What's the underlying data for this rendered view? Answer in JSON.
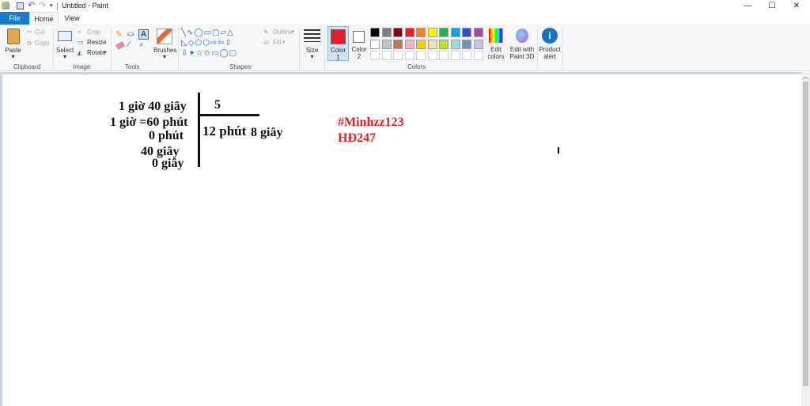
{
  "window": {
    "title": "Untitled - Paint",
    "minimize": "—",
    "maximize": "☐",
    "close": "✕"
  },
  "tabs": {
    "file": "File",
    "home": "Home",
    "view": "View"
  },
  "clipboard": {
    "paste": "Paste",
    "cut": "Cut",
    "copy": "Copy",
    "group": "Clipboard"
  },
  "image": {
    "select": "Select",
    "crop": "Crop",
    "resize": "Resize",
    "rotate": "Rotate",
    "group": "Image"
  },
  "tools": {
    "group": "Tools",
    "brushes": "Brushes"
  },
  "shapes": {
    "group": "Shapes",
    "outline": "Outline",
    "fill": "Fill",
    "size": "Size"
  },
  "colors": {
    "color1": "Color 1",
    "color2": "Color 2",
    "group": "Colors",
    "edit_colors": "Edit colors",
    "edit_paint3d": "Edit with Paint 3D",
    "product_alert": "Product alert",
    "color1_value": "#e02127",
    "color2_value": "#ffffff",
    "palette_row1": [
      "#000000",
      "#7f7f7f",
      "#880015",
      "#ed1c24",
      "#ff7f27",
      "#fff200",
      "#22b14c",
      "#00a2e8",
      "#3f48cc",
      "#a349a4"
    ],
    "palette_row2": [
      "#ffffff",
      "#c3c3c3",
      "#b97a57",
      "#ffaec9",
      "#ffc90e",
      "#efe4b0",
      "#b5e61d",
      "#99d9ea",
      "#7092be",
      "#c8bfe7"
    ]
  },
  "canvas_text": {
    "line1": "1 giờ 40 giây",
    "line2": "1 giờ =60 phút",
    "line3": "0 phút",
    "line4": "40 giây",
    "line5": "0 giây",
    "divisor": "5",
    "quotient_a": "12 phút",
    "quotient_b": "8 giây",
    "tag1": "#Minhzz123",
    "tag2": "HĐ247"
  }
}
